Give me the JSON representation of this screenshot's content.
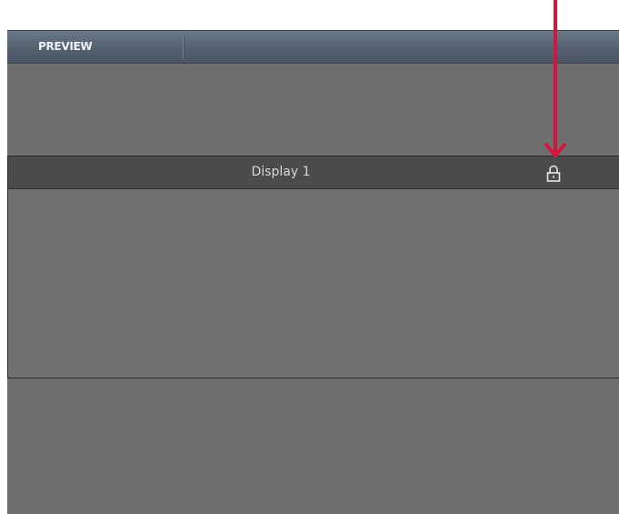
{
  "tabs": [
    {
      "label": "PREVIEW"
    }
  ],
  "display": {
    "title": "Display 1",
    "lock_icon": "lock-icon"
  },
  "annotation": {
    "arrow_color": "#d4163c"
  },
  "colors": {
    "tabbar": "#566170",
    "panel": "#6f6f6f",
    "display_header": "#4b4b4b",
    "text_light": "#d8d8d8"
  }
}
